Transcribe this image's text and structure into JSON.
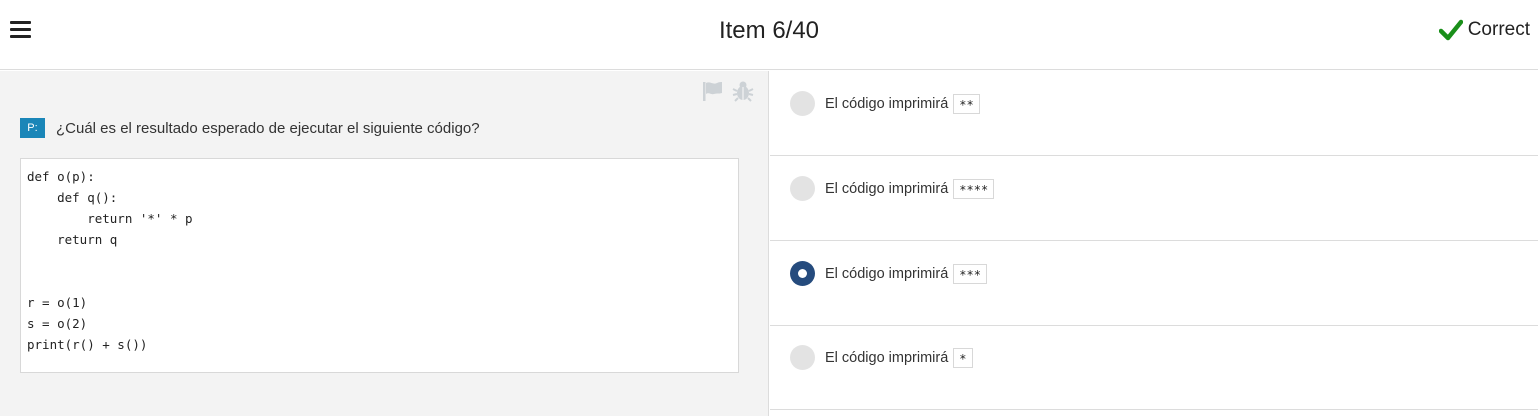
{
  "header": {
    "title": "Item 6/40",
    "status_text": "Correct",
    "status_color": "#1a8f1a"
  },
  "icons": {
    "menu": "hamburger-menu-icon",
    "status": "checkmark-icon",
    "flag": "flag-icon",
    "bug": "bug-icon"
  },
  "question": {
    "badge": "P:",
    "text": "¿Cuál es el resultado esperado de ejecutar el siguiente código?",
    "code": "def o(p):\n    def q():\n        return '*' * p\n    return q\n\n\nr = o(1)\ns = o(2)\nprint(r() + s())"
  },
  "options": [
    {
      "label": "El código imprimirá",
      "code": "**",
      "selected": false
    },
    {
      "label": "El código imprimirá",
      "code": "****",
      "selected": false
    },
    {
      "label": "El código imprimirá",
      "code": "***",
      "selected": true
    },
    {
      "label": "El código imprimirá",
      "code": "*",
      "selected": false
    }
  ],
  "colors": {
    "accent": "#254b7d",
    "badge": "#1a86b8",
    "panel_bg": "#f3f3f3"
  }
}
